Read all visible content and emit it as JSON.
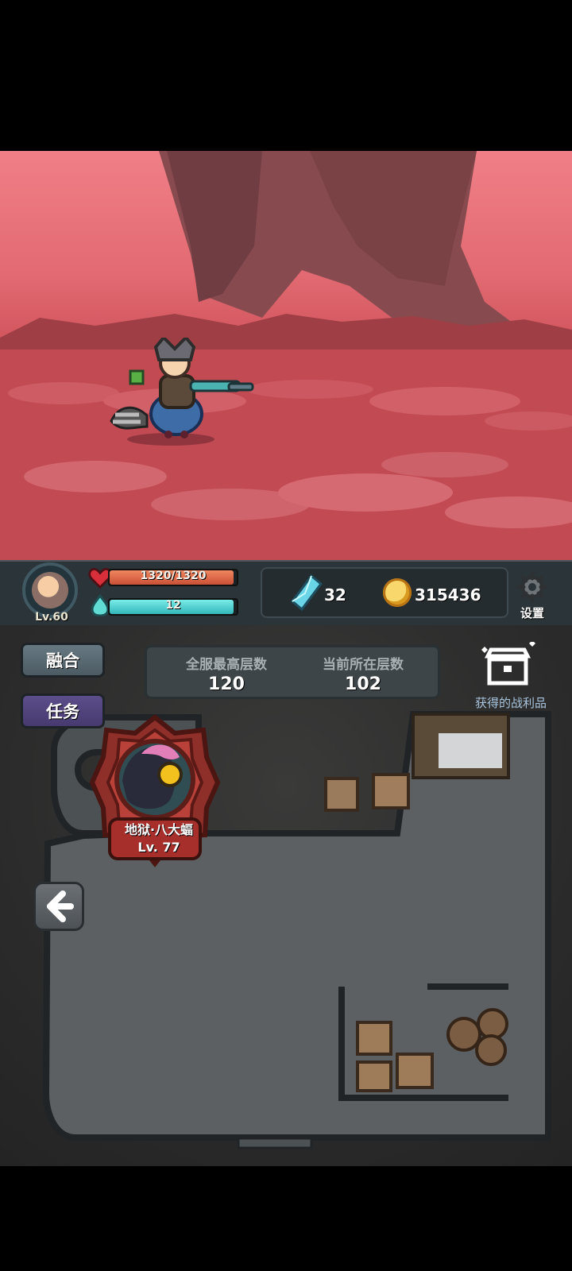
{
  "hud": {
    "avatar_level": "Lv.60",
    "hp": "1320/1320",
    "mp": "12",
    "gems": "32",
    "coins": "315436",
    "settings_label": "设置"
  },
  "lower": {
    "buttons": [
      {
        "label": "融合"
      },
      {
        "label": "任务"
      }
    ],
    "floors": {
      "server_best_label": "全服最高层数",
      "server_best_value": "120",
      "current_floor_label": "当前所在层数",
      "current_floor_value": "102"
    },
    "loot_label": "获得的战利品",
    "boss": {
      "name": "地狱·八大蝠",
      "level": "Lv. 77"
    }
  },
  "colors": {
    "scene_sky": "#f07f87",
    "scene_ground": "#b8424c",
    "hud_bg": "#2b3438",
    "hp": "#c95035",
    "mp": "#34b7ba",
    "fuse_btn": "#4c5b63",
    "task_btn": "#463a70",
    "dungeon_floor": "#5c6062"
  }
}
